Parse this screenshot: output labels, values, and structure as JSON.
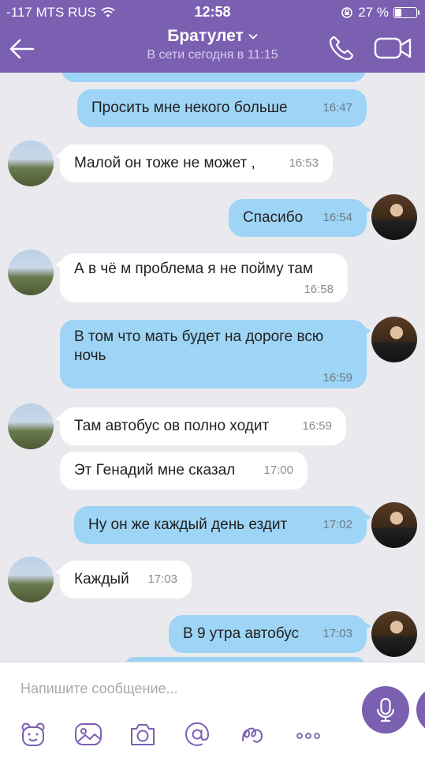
{
  "status_bar": {
    "carrier": "-117 MTS RUS",
    "time": "12:58",
    "battery_percent": "27 %",
    "battery_level": 0.27
  },
  "header": {
    "contact_name": "Братулет",
    "presence": "В сети сегодня в 11:15",
    "accent_color": "#7b5fb1"
  },
  "messages": [
    {
      "direction": "out",
      "text": "Просить мне некого больше",
      "time": "16:47"
    },
    {
      "direction": "in",
      "text": "Малой он тоже не может ,",
      "time": "16:53"
    },
    {
      "direction": "out",
      "text": "Спасибо",
      "time": "16:54"
    },
    {
      "direction": "in",
      "text": "А в чё м проблема я не пойму там",
      "time": "16:58"
    },
    {
      "direction": "out",
      "text_line1": "В том что мать будет на дороге всю",
      "text_line2": "ночь",
      "time": "16:59"
    },
    {
      "direction": "in",
      "text": "Там автобус ов полно ходит",
      "time": "16:59"
    },
    {
      "direction": "in",
      "text": "Эт Генадий мне сказал",
      "time": "17:00"
    },
    {
      "direction": "out",
      "text": "Ну он же каждый день ездит",
      "time": "17:02"
    },
    {
      "direction": "in",
      "text": "Каждый",
      "time": "17:03"
    },
    {
      "direction": "out",
      "text": "В 9 утра автобус",
      "time": "17:03"
    }
  ],
  "composer": {
    "placeholder": "Напишите сообщение...",
    "tools": [
      "sticker-icon",
      "gallery-icon",
      "camera-icon",
      "mention-icon",
      "doodle-icon",
      "more-icon"
    ]
  }
}
